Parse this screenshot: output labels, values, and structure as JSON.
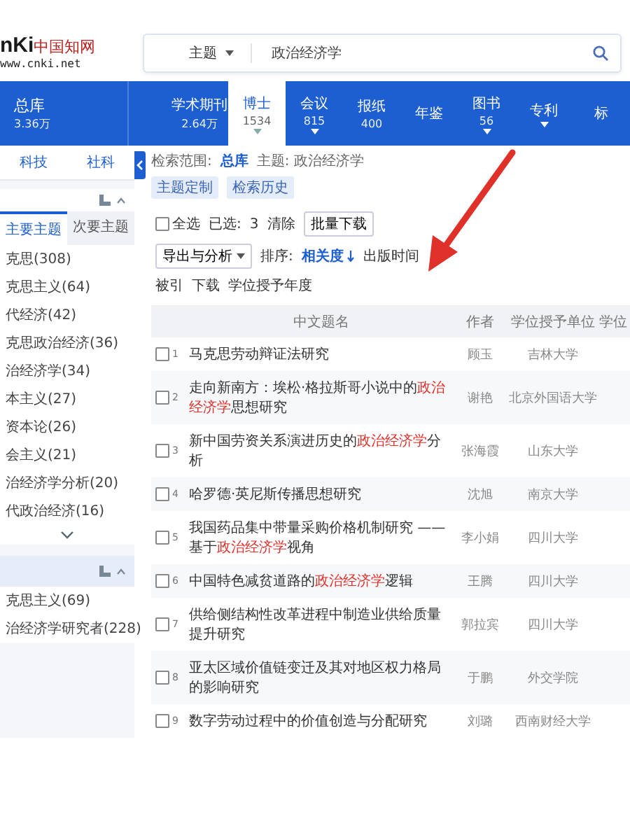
{
  "header": {
    "logo_mark": "nKi",
    "logo_name": "中国知网",
    "logo_url": "www.cnki.net",
    "field": "主题",
    "query": "政治经济学"
  },
  "nav": {
    "total": {
      "label": "总库",
      "count": "3.36万"
    },
    "tabs": [
      {
        "label": "学术期刊",
        "count": "2.64万",
        "selected": false,
        "dropdown": false
      },
      {
        "label": "博士",
        "count": "1534",
        "selected": true,
        "dropdown": true
      },
      {
        "label": "会议",
        "count": "815",
        "selected": false,
        "dropdown": true
      },
      {
        "label": "报纸",
        "count": "400",
        "selected": false,
        "dropdown": false
      },
      {
        "label": "年鉴",
        "selected": false,
        "dropdown": false
      },
      {
        "label": "图书",
        "count": "56",
        "selected": false,
        "dropdown": true
      },
      {
        "label": "专利",
        "selected": false,
        "dropdown": true
      },
      {
        "label": "标",
        "selected": false,
        "dropdown": false
      }
    ]
  },
  "sidebar": {
    "categories": [
      "科技",
      "社科"
    ],
    "topic_tabs": [
      {
        "label": "主要主题",
        "selected": true
      },
      {
        "label": "次要主题",
        "selected": false
      }
    ],
    "topics": [
      "克思(308)",
      "克思主义(64)",
      "代经济(42)",
      "克思政治经济(36)",
      "治经济学(34)",
      "本主义(27)",
      "资本论(26)",
      "会主义(21)",
      "治经济学分析(20)",
      "代政治经济(16)"
    ],
    "section2_items": [
      "克思主义(69)",
      "治经济学研究者(228)"
    ]
  },
  "scope": {
    "label": "检索范围:",
    "value": "总库",
    "query": "主题: 政治经济学",
    "chips": [
      "主题定制",
      "检索历史"
    ]
  },
  "toolbar": {
    "select_all": "全选",
    "select_all_checked": false,
    "selected_label": "已选:",
    "selected_count": "3",
    "clear": "清除",
    "batch": "批量下载",
    "export": "导出与分析",
    "sort_label": "排序:",
    "sorts": [
      {
        "label": "相关度",
        "selected": true
      },
      {
        "label": "出版时间",
        "selected": false
      },
      {
        "label": "被引",
        "selected": false
      },
      {
        "label": "下载",
        "selected": false
      },
      {
        "label": "学位授予年度",
        "selected": false
      }
    ]
  },
  "table": {
    "columns": [
      "中文题名",
      "作者",
      "学位授予单位",
      "学位"
    ],
    "rows": [
      {
        "num": "1",
        "checked": false,
        "title": [
          {
            "text": "马克思劳动辩证法研究",
            "highlight": false
          }
        ],
        "author": "顾玉",
        "unit": "吉林大学"
      },
      {
        "num": "2",
        "checked": false,
        "title": [
          {
            "text": "走向新南方：埃松·格拉斯哥小说中的",
            "highlight": false
          },
          {
            "text": "政治经济学",
            "highlight": true
          },
          {
            "text": "思想研究",
            "highlight": false
          }
        ],
        "author": "谢艳",
        "unit": "北京外国语大学"
      },
      {
        "num": "3",
        "checked": false,
        "title": [
          {
            "text": "新中国劳资关系演进历史的",
            "highlight": false
          },
          {
            "text": "政治经济学",
            "highlight": true
          },
          {
            "text": "分析",
            "highlight": false
          }
        ],
        "author": "张海霞",
        "unit": "山东大学"
      },
      {
        "num": "4",
        "checked": false,
        "title": [
          {
            "text": "哈罗德·英尼斯传播思想研究",
            "highlight": false
          }
        ],
        "author": "沈旭",
        "unit": "南京大学"
      },
      {
        "num": "5",
        "checked": false,
        "title": [
          {
            "text": "我国药品集中带量采购价格机制研究 ——基于",
            "highlight": false
          },
          {
            "text": "政治经济学",
            "highlight": true
          },
          {
            "text": "视角",
            "highlight": false
          }
        ],
        "author": "李小娟",
        "unit": "四川大学"
      },
      {
        "num": "6",
        "checked": false,
        "title": [
          {
            "text": "中国特色减贫道路的",
            "highlight": false
          },
          {
            "text": "政治经济学",
            "highlight": true
          },
          {
            "text": "逻辑",
            "highlight": false
          }
        ],
        "author": "王腾",
        "unit": "四川大学"
      },
      {
        "num": "7",
        "checked": false,
        "title": [
          {
            "text": "供给侧结构性改革进程中制造业供给质量提升研究",
            "highlight": false
          }
        ],
        "author": "郭拉宾",
        "unit": "四川大学"
      },
      {
        "num": "8",
        "checked": false,
        "title": [
          {
            "text": "亚太区域价值链变迁及其对地区权力格局的影响研究",
            "highlight": false
          }
        ],
        "author": "于鹏",
        "unit": "外交学院"
      },
      {
        "num": "9",
        "checked": false,
        "title": [
          {
            "text": "数字劳动过程中的价值创造与分配研究",
            "highlight": false
          }
        ],
        "author": "刘璐",
        "unit": "西南财经大学"
      }
    ]
  }
}
